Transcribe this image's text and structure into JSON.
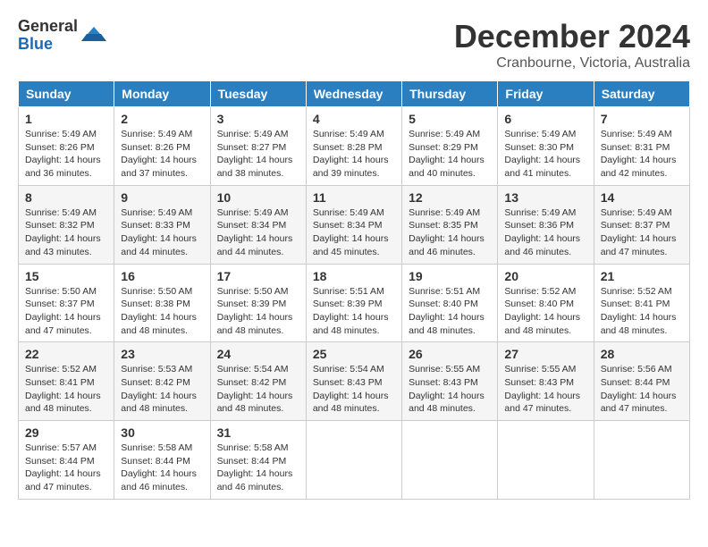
{
  "logo": {
    "general": "General",
    "blue": "Blue"
  },
  "header": {
    "month": "December 2024",
    "location": "Cranbourne, Victoria, Australia"
  },
  "weekdays": [
    "Sunday",
    "Monday",
    "Tuesday",
    "Wednesday",
    "Thursday",
    "Friday",
    "Saturday"
  ],
  "weeks": [
    [
      {
        "day": "1",
        "sunrise": "5:49 AM",
        "sunset": "8:26 PM",
        "daylight": "14 hours and 36 minutes."
      },
      {
        "day": "2",
        "sunrise": "5:49 AM",
        "sunset": "8:26 PM",
        "daylight": "14 hours and 37 minutes."
      },
      {
        "day": "3",
        "sunrise": "5:49 AM",
        "sunset": "8:27 PM",
        "daylight": "14 hours and 38 minutes."
      },
      {
        "day": "4",
        "sunrise": "5:49 AM",
        "sunset": "8:28 PM",
        "daylight": "14 hours and 39 minutes."
      },
      {
        "day": "5",
        "sunrise": "5:49 AM",
        "sunset": "8:29 PM",
        "daylight": "14 hours and 40 minutes."
      },
      {
        "day": "6",
        "sunrise": "5:49 AM",
        "sunset": "8:30 PM",
        "daylight": "14 hours and 41 minutes."
      },
      {
        "day": "7",
        "sunrise": "5:49 AM",
        "sunset": "8:31 PM",
        "daylight": "14 hours and 42 minutes."
      }
    ],
    [
      {
        "day": "8",
        "sunrise": "5:49 AM",
        "sunset": "8:32 PM",
        "daylight": "14 hours and 43 minutes."
      },
      {
        "day": "9",
        "sunrise": "5:49 AM",
        "sunset": "8:33 PM",
        "daylight": "14 hours and 44 minutes."
      },
      {
        "day": "10",
        "sunrise": "5:49 AM",
        "sunset": "8:34 PM",
        "daylight": "14 hours and 44 minutes."
      },
      {
        "day": "11",
        "sunrise": "5:49 AM",
        "sunset": "8:34 PM",
        "daylight": "14 hours and 45 minutes."
      },
      {
        "day": "12",
        "sunrise": "5:49 AM",
        "sunset": "8:35 PM",
        "daylight": "14 hours and 46 minutes."
      },
      {
        "day": "13",
        "sunrise": "5:49 AM",
        "sunset": "8:36 PM",
        "daylight": "14 hours and 46 minutes."
      },
      {
        "day": "14",
        "sunrise": "5:49 AM",
        "sunset": "8:37 PM",
        "daylight": "14 hours and 47 minutes."
      }
    ],
    [
      {
        "day": "15",
        "sunrise": "5:50 AM",
        "sunset": "8:37 PM",
        "daylight": "14 hours and 47 minutes."
      },
      {
        "day": "16",
        "sunrise": "5:50 AM",
        "sunset": "8:38 PM",
        "daylight": "14 hours and 48 minutes."
      },
      {
        "day": "17",
        "sunrise": "5:50 AM",
        "sunset": "8:39 PM",
        "daylight": "14 hours and 48 minutes."
      },
      {
        "day": "18",
        "sunrise": "5:51 AM",
        "sunset": "8:39 PM",
        "daylight": "14 hours and 48 minutes."
      },
      {
        "day": "19",
        "sunrise": "5:51 AM",
        "sunset": "8:40 PM",
        "daylight": "14 hours and 48 minutes."
      },
      {
        "day": "20",
        "sunrise": "5:52 AM",
        "sunset": "8:40 PM",
        "daylight": "14 hours and 48 minutes."
      },
      {
        "day": "21",
        "sunrise": "5:52 AM",
        "sunset": "8:41 PM",
        "daylight": "14 hours and 48 minutes."
      }
    ],
    [
      {
        "day": "22",
        "sunrise": "5:52 AM",
        "sunset": "8:41 PM",
        "daylight": "14 hours and 48 minutes."
      },
      {
        "day": "23",
        "sunrise": "5:53 AM",
        "sunset": "8:42 PM",
        "daylight": "14 hours and 48 minutes."
      },
      {
        "day": "24",
        "sunrise": "5:54 AM",
        "sunset": "8:42 PM",
        "daylight": "14 hours and 48 minutes."
      },
      {
        "day": "25",
        "sunrise": "5:54 AM",
        "sunset": "8:43 PM",
        "daylight": "14 hours and 48 minutes."
      },
      {
        "day": "26",
        "sunrise": "5:55 AM",
        "sunset": "8:43 PM",
        "daylight": "14 hours and 48 minutes."
      },
      {
        "day": "27",
        "sunrise": "5:55 AM",
        "sunset": "8:43 PM",
        "daylight": "14 hours and 47 minutes."
      },
      {
        "day": "28",
        "sunrise": "5:56 AM",
        "sunset": "8:44 PM",
        "daylight": "14 hours and 47 minutes."
      }
    ],
    [
      {
        "day": "29",
        "sunrise": "5:57 AM",
        "sunset": "8:44 PM",
        "daylight": "14 hours and 47 minutes."
      },
      {
        "day": "30",
        "sunrise": "5:58 AM",
        "sunset": "8:44 PM",
        "daylight": "14 hours and 46 minutes."
      },
      {
        "day": "31",
        "sunrise": "5:58 AM",
        "sunset": "8:44 PM",
        "daylight": "14 hours and 46 minutes."
      },
      null,
      null,
      null,
      null
    ]
  ],
  "labels": {
    "sunrise": "Sunrise:",
    "sunset": "Sunset:",
    "daylight": "Daylight:"
  }
}
